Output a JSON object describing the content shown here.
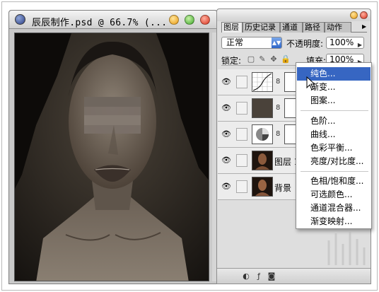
{
  "document": {
    "title": "辰辰制作.psd @ 66.7% (..."
  },
  "layers_panel": {
    "tabs": [
      "图层",
      "历史记录",
      "通道",
      "路径",
      "动作"
    ],
    "active_tab": "图层",
    "blend_mode": "正常",
    "opacity_label": "不透明度:",
    "opacity_value": "100%",
    "lock_label": "锁定:",
    "fill_label": "填充:",
    "fill_value": "100%",
    "layers": [
      {
        "name": "",
        "type": "curves-adjustment"
      },
      {
        "name": "",
        "type": "solid-fill"
      },
      {
        "name": "",
        "type": "adjustment"
      },
      {
        "name": "图层 1",
        "type": "image"
      },
      {
        "name": "背景",
        "type": "image"
      }
    ]
  },
  "adjustment_menu": {
    "items": [
      {
        "label": "纯色...",
        "highlighted": true
      },
      {
        "label": "渐变..."
      },
      {
        "label": "图案..."
      },
      {
        "label": "色阶..."
      },
      {
        "label": "曲线..."
      },
      {
        "label": "色彩平衡..."
      },
      {
        "label": "亮度/对比度..."
      },
      {
        "label": "色相/饱和度..."
      },
      {
        "label": "可选颜色..."
      },
      {
        "label": "通道混合器..."
      },
      {
        "label": "渐变映射..."
      }
    ]
  },
  "colors": {
    "menu_highlight": "#3766c2",
    "blend_arrow": "#2f66c8",
    "close": "#d8331e",
    "minimize": "#e89a12",
    "zoom": "#3ea82a"
  }
}
